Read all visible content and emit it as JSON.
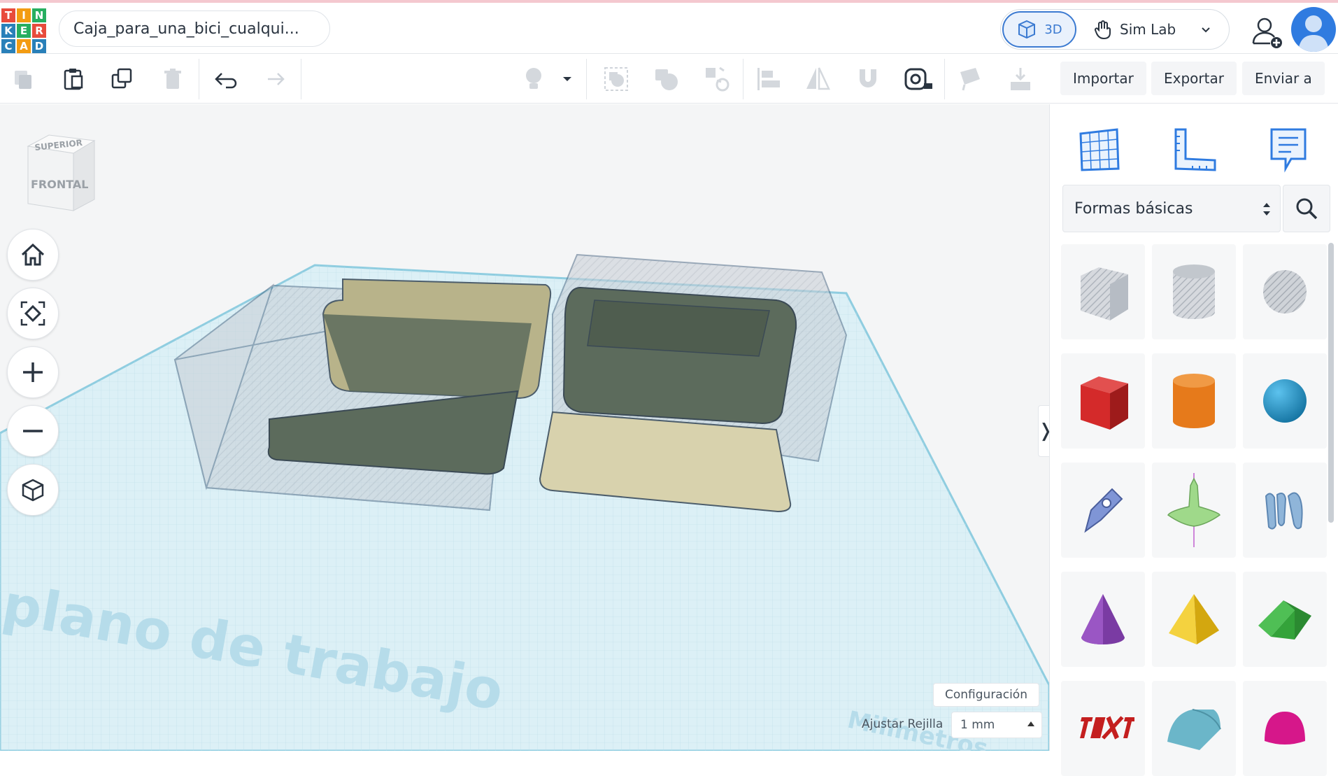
{
  "app": {
    "logo_letters": [
      "T",
      "I",
      "N",
      "K",
      "E",
      "R",
      "C",
      "A",
      "D"
    ],
    "logo_colors": [
      "#e84b3c",
      "#f39c12",
      "#27ae60",
      "#2980b9",
      "#27ae60",
      "#e84b3c",
      "#2980b9",
      "#f39c12",
      "#2980b9"
    ],
    "design_title": "Caja_para_una_bici_cualqui...",
    "accent": "#3b7ad1"
  },
  "header": {
    "view_3d_label": "3D",
    "simlab_label": "Sim Lab",
    "icons": [
      "cube-icon",
      "hand-icon",
      "chevron-down-icon",
      "add-user-icon",
      "avatar-icon"
    ]
  },
  "toolbar": {
    "icons": [
      "copy-icon",
      "paste-icon",
      "duplicate-icon",
      "delete-icon",
      "undo-icon",
      "redo-icon",
      "light-icon",
      "dropdown-icon",
      "group-icon",
      "ungroup-icon",
      "cruise-icon",
      "align-icon",
      "mirror-icon",
      "workplane-magnet-icon",
      "ruler-tape-icon",
      "paint-icon",
      "drop-icon"
    ],
    "import_label": "Importar",
    "export_label": "Exportar",
    "send_label": "Enviar a"
  },
  "viewport": {
    "viewcube_top": "SUPERIOR",
    "viewcube_front": "FRONTAL",
    "workplane_label": "plano de trabajo",
    "units_label": "Milímetros",
    "settings_label": "Configuración",
    "grid_label": "Ajustar Rejilla",
    "grid_value": "1 mm",
    "nav_icons": [
      "home-icon",
      "fit-icon",
      "zoom-in-icon",
      "zoom-out-icon",
      "perspective-icon"
    ],
    "collapse_glyph": "❭"
  },
  "panel": {
    "tool_icons": [
      "workplane-grid-icon",
      "ruler-icon",
      "notes-icon"
    ],
    "category_label": "Formas básicas",
    "shapes": [
      {
        "name": "box-hole-shape"
      },
      {
        "name": "cylinder-hole-shape"
      },
      {
        "name": "sphere-hole-shape"
      },
      {
        "name": "box-shape",
        "color": "#d42a2a"
      },
      {
        "name": "cylinder-shape",
        "color": "#e67a1b"
      },
      {
        "name": "sphere-shape",
        "color": "#1b8fc7"
      },
      {
        "name": "scribble-shape",
        "color": "#7f95d6"
      },
      {
        "name": "graphic-shape",
        "color": "#9fd98a"
      },
      {
        "name": "text-3d-shape",
        "color": "#8fb5d9"
      },
      {
        "name": "cone-shape",
        "color": "#7a3ba3"
      },
      {
        "name": "pyramid-shape",
        "color": "#f1c21b"
      },
      {
        "name": "roof-shape",
        "color": "#34a33a"
      },
      {
        "name": "text-shape",
        "color": "#c41f1f"
      },
      {
        "name": "half-cylinder-shape",
        "color": "#6bb6c9"
      },
      {
        "name": "paraboloid-shape",
        "color": "#d6178a"
      }
    ]
  }
}
